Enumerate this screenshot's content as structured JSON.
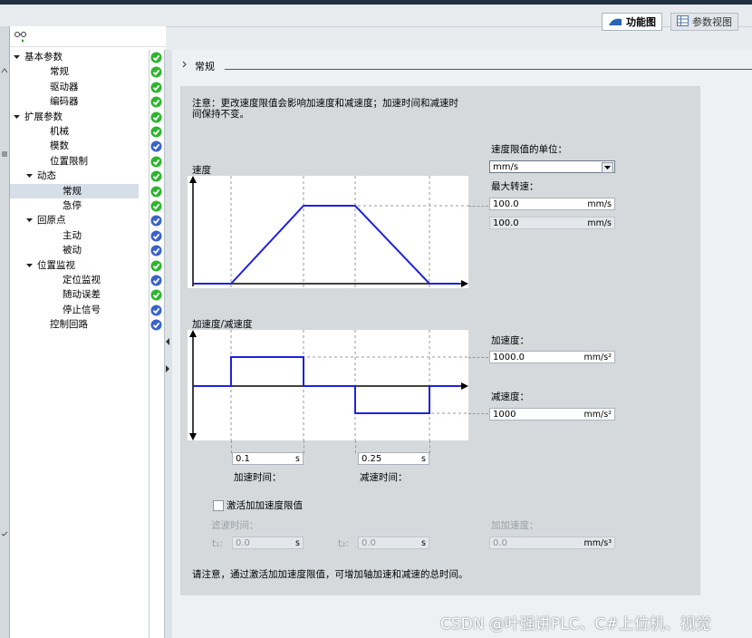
{
  "header": {
    "tabs": [
      {
        "label": "功能图",
        "active": true
      },
      {
        "label": "参数视图",
        "active": false
      }
    ]
  },
  "tree": {
    "items": [
      {
        "label": "基本参数",
        "expanded": true,
        "status": "ok"
      },
      {
        "label": "常规",
        "status": "ok"
      },
      {
        "label": "驱动器",
        "status": "ok"
      },
      {
        "label": "编码器",
        "status": "ok"
      },
      {
        "label": "扩展参数",
        "expanded": true,
        "status": "ok"
      },
      {
        "label": "机械",
        "status": "ok"
      },
      {
        "label": "模数",
        "status": "info"
      },
      {
        "label": "位置限制",
        "status": "ok"
      },
      {
        "label": "动态",
        "expanded": true,
        "status": "ok"
      },
      {
        "label": "常规",
        "status": "ok",
        "selected": true
      },
      {
        "label": "急停",
        "status": "ok"
      },
      {
        "label": "回原点",
        "expanded": true,
        "status": "info"
      },
      {
        "label": "主动",
        "status": "info"
      },
      {
        "label": "被动",
        "status": "info"
      },
      {
        "label": "位置监视",
        "expanded": true,
        "status": "ok"
      },
      {
        "label": "定位监视",
        "status": "info"
      },
      {
        "label": "随动误差",
        "status": "ok"
      },
      {
        "label": "停止信号",
        "status": "info"
      },
      {
        "label": "控制回路",
        "status": "info"
      }
    ]
  },
  "section": {
    "title": "常规"
  },
  "notice": "注意：更改速度限值会影响加速度和减速度；加速时间和减速时间保持不变。",
  "velocity": {
    "graph_label": "速度",
    "unit_label": "速度限值的单位：",
    "unit_value": "mm/s",
    "max_speed_label": "最大转速：",
    "max_speed_value": "100.0",
    "max_speed_unit": "mm/s",
    "start_stop_value": "100.0",
    "start_stop_unit": "mm/s"
  },
  "accel": {
    "graph_label": "加速度/减速度",
    "accel_label": "加速度：",
    "accel_value": "1000.0",
    "accel_unit": "mm/s²",
    "decel_label": "减速度：",
    "decel_value": "1000",
    "decel_unit": "mm/s²",
    "accel_time_value": "0.1",
    "accel_time_unit": "s",
    "accel_time_label": "加速时间：",
    "decel_time_value": "0.25",
    "decel_time_unit": "s",
    "decel_time_label": "减速时间："
  },
  "jerk": {
    "checkbox_label": "激活加加速度限值",
    "checked": false,
    "filter_label": "滤波时间：",
    "t1_label": "t₁:",
    "t1_value": "0.0",
    "t1_unit": "s",
    "t2_label": "t₂:",
    "t2_value": "0.0",
    "t2_unit": "s",
    "jerk_label": "加加速度：",
    "jerk_value": "0.0",
    "jerk_unit": "mm/s³"
  },
  "footer_note": "请注意，通过激活加加速度限值，可增加轴加速和减速的总时间。",
  "watermark": "CSDN @叶强讲PLC、C#上位机、视觉",
  "colors": {
    "ok": "#2db52d",
    "info": "#3a63c8",
    "plot": "#2020e0"
  }
}
